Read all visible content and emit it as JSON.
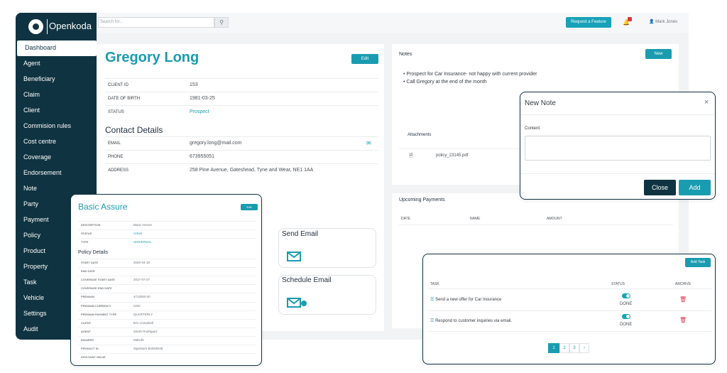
{
  "brand": {
    "name": "Openkoda"
  },
  "topbar": {
    "search_placeholder": "Search for...",
    "search_icon": "search-icon",
    "feature_button": "Request a Feature",
    "user_name": "Mark Jones"
  },
  "sidebar": {
    "items": [
      "Dashboard",
      "Agent",
      "Beneficiary",
      "Claim",
      "Client",
      "Commision rules",
      "Cost centre",
      "Coverage",
      "Endorsement",
      "Note",
      "Party",
      "Payment",
      "Policy",
      "Product",
      "Property",
      "Task",
      "Vehicle",
      "Settings",
      "Audit"
    ],
    "active": "Dashboard"
  },
  "client": {
    "name": "Gregory Long",
    "edit_label": "Edit",
    "fields": [
      {
        "label": "CLIENT ID",
        "value": "153"
      },
      {
        "label": "DATE OF BIRTH",
        "value": "1981-03-25"
      },
      {
        "label": "STATUS",
        "value": "Prospect"
      }
    ],
    "contact_title": "Contact Details",
    "contact": [
      {
        "label": "EMAIL",
        "value": "gregory.long@mail.com"
      },
      {
        "label": "PHONE",
        "value": "673955051"
      },
      {
        "label": "ADDRESS",
        "value": "258 Pine Avenue, Gateshead, Tyne and Wear, NE1 1AA"
      }
    ]
  },
  "notes": {
    "title": "Notes",
    "new_label": "New",
    "items": [
      "Prospect for Car Insurance- not happy with current provider",
      "Call Gregory at the end of the month"
    ],
    "attachments_title": "Attachments",
    "attachment_file": "policy_23145.pdf"
  },
  "new_note_modal": {
    "title": "New Note",
    "close_x": "×",
    "content_label": "Content:",
    "close_button": "Close",
    "add_button": "Add"
  },
  "payments": {
    "title": "Upcoming Payments",
    "columns": [
      "DATE",
      "NAME",
      "AMOUNT"
    ]
  },
  "email_cards": {
    "send_email": "Send Email",
    "schedule_email": "Schedule Email"
  },
  "policy": {
    "title": "Basic Assure",
    "edit_label": "Edit",
    "fields": [
      {
        "label": "DESCRIPTION",
        "value": "Basic Assure"
      },
      {
        "label": "STATUS",
        "value": "Active"
      },
      {
        "label": "TYPE",
        "value": "UNIVERSAL"
      }
    ],
    "details_title": "Policy Details",
    "details": [
      {
        "label": "START DATE",
        "value": "2020-04-19"
      },
      {
        "label": "END DATE",
        "value": ""
      },
      {
        "label": "COVERAGE START DATE",
        "value": "2017-07-27"
      },
      {
        "label": "COVERAGE END DATE",
        "value": ""
      },
      {
        "label": "PREMIUM",
        "value": "4713000.00"
      },
      {
        "label": "PREMIUM CURRENCY",
        "value": "USD"
      },
      {
        "label": "PREMIUM PAYMENT TYPE",
        "value": "QUARTERLY"
      },
      {
        "label": "CLIENT",
        "value": "Eric Campbell"
      },
      {
        "label": "AGENT",
        "value": "Sarah Rodriguez"
      },
      {
        "label": "INSURER",
        "value": "MetLife"
      },
      {
        "label": "PRODUCT ID",
        "value": "Signature Boldshield"
      },
      {
        "label": "DISCOUNT VALUE",
        "value": ""
      }
    ]
  },
  "tasks": {
    "add_label": "Add Task",
    "columns": [
      "TASK",
      "STATUS",
      "ARCHIVE"
    ],
    "rows": [
      {
        "task": "Send a new offer for Car Insurance",
        "status": "DONE"
      },
      {
        "task": "Respond to customer inquiries via email.",
        "status": "DONE"
      }
    ],
    "pages": [
      "1",
      "2",
      "3",
      "›"
    ]
  }
}
